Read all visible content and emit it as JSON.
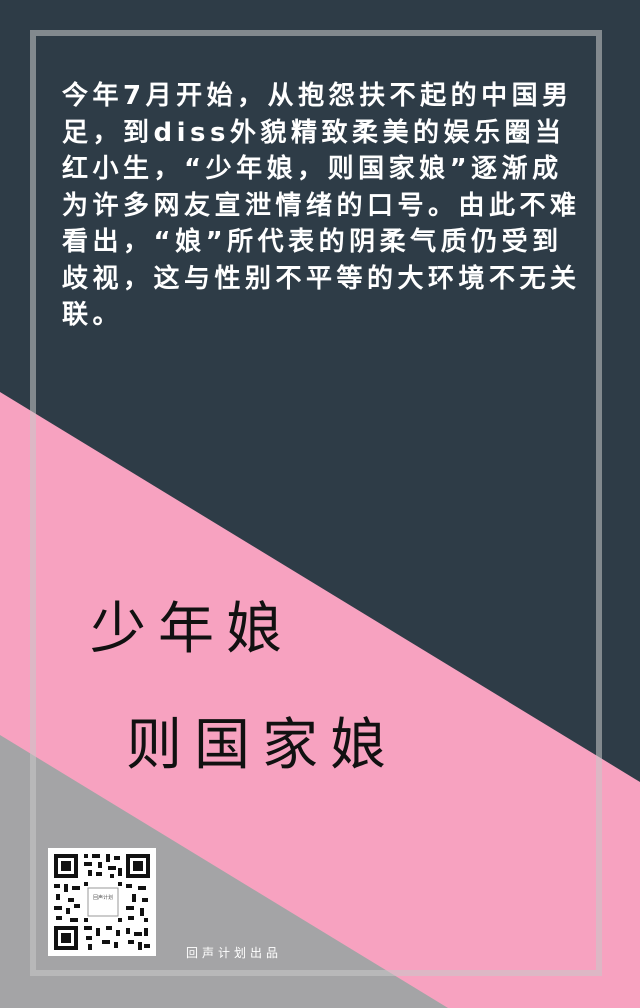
{
  "paragraph": "今年7月开始，从抱怨扶不起的中国男足，到diss外貌精致柔美的娱乐圈当红小生，“少年娘，则国家娘”逐渐成为许多网友宣泄情绪的口号。由此不难看出，“娘”所代表的阴柔气质仍受到歧视，这与性别不平等的大环境不无关联。",
  "title": {
    "line1": "少年娘",
    "line2": "则国家娘"
  },
  "qr_code": {
    "center_text": "回声计划"
  },
  "credit": "回声计划出品",
  "colors": {
    "dark_slate": "#2e3c47",
    "pink": "#f7a2c0",
    "gray": "#a4a4a6",
    "frame": "#c8c8c8"
  }
}
